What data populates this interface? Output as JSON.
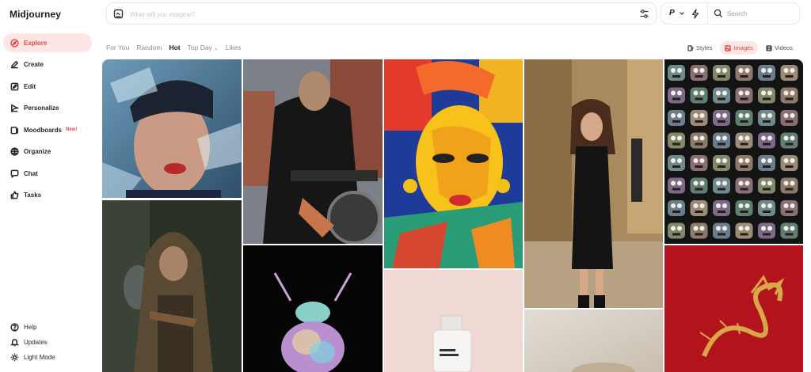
{
  "app": {
    "name": "Midjourney"
  },
  "sidebar": {
    "items": [
      {
        "label": "Explore",
        "icon": "compass-icon",
        "active": true
      },
      {
        "label": "Create",
        "icon": "pencil-icon"
      },
      {
        "label": "Edit",
        "icon": "edit-icon"
      },
      {
        "label": "Personalize",
        "icon": "personalize-icon"
      },
      {
        "label": "Moodboards",
        "icon": "moodboard-icon",
        "badge": "New!"
      },
      {
        "label": "Organize",
        "icon": "grid-icon"
      },
      {
        "label": "Chat",
        "icon": "chat-icon"
      },
      {
        "label": "Tasks",
        "icon": "thumbs-up-icon"
      }
    ],
    "bottom": [
      {
        "label": "Help",
        "icon": "help-icon"
      },
      {
        "label": "Updates",
        "icon": "bell-icon"
      },
      {
        "label": "Light Mode",
        "icon": "sun-icon"
      }
    ]
  },
  "prompt": {
    "placeholder": "What will you imagine?"
  },
  "top_tools": {
    "p_label": "P",
    "search_label": "Search"
  },
  "filters": {
    "tabs": [
      "For You",
      "Random",
      "Hot",
      "Top Day",
      "Likes"
    ],
    "active": "Hot"
  },
  "views": {
    "tabs": [
      "Styles",
      "Images",
      "Videos"
    ],
    "active": "Images"
  },
  "colors": {
    "accent": "#e8473f",
    "accent_bg": "#fde6e4"
  }
}
